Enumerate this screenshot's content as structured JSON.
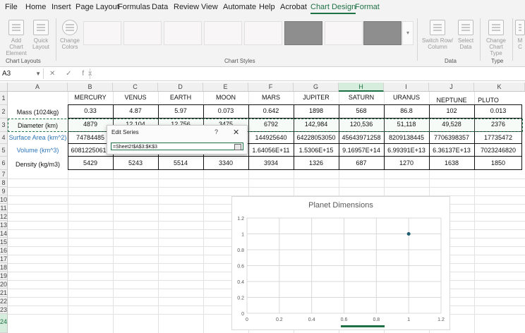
{
  "menu": {
    "tabs": [
      "File",
      "Home",
      "Insert",
      "Page Layout",
      "Formulas",
      "Data",
      "Review",
      "View",
      "Automate",
      "Help",
      "Acrobat",
      "Chart Design",
      "Format"
    ],
    "active": "Chart Design"
  },
  "ribbon": {
    "add_chart_element": "Add Chart Element",
    "quick_layout": "Quick Layout",
    "change_colors": "Change Colors",
    "chart_layouts_label": "Chart Layouts",
    "chart_styles_label": "Chart Styles",
    "switch_row_column": "Switch Row/ Column",
    "select_data": "Select Data",
    "data_label": "Data",
    "change_chart_type": "Change Chart Type",
    "type_label": "Type",
    "move_chart": "M C"
  },
  "formula_bar": {
    "name_box": "A3",
    "icons": "✕ ✓ fx",
    "formula": ""
  },
  "columns": [
    "A",
    "B",
    "C",
    "D",
    "E",
    "F",
    "G",
    "H",
    "I",
    "J",
    "K"
  ],
  "selected_column": "H",
  "rows": [
    "1",
    "2",
    "3",
    "4",
    "5",
    "6",
    "7",
    "8",
    "9",
    "10",
    "11",
    "12",
    "13",
    "14",
    "15",
    "16",
    "17",
    "18",
    "19",
    "20",
    "21",
    "22",
    "23",
    "24"
  ],
  "sheet": {
    "headers": [
      "",
      "MERCURY",
      "VENUS",
      "EARTH",
      "MOON",
      "MARS",
      "JUPITER",
      "SATURN",
      "URANUS",
      "NEPTUNE",
      "PLUTO"
    ],
    "mass": [
      "Mass (1024kg)",
      "0.33",
      "4.87",
      "5.97",
      "0.073",
      "0.642",
      "1898",
      "568",
      "86.8",
      "102",
      "0.013"
    ],
    "diameter": [
      "Diameter (km)",
      "4879",
      "12,104",
      "12,756",
      "3475",
      "6792",
      "142,984",
      "120,536",
      "51,118",
      "49,528",
      "2376"
    ],
    "surface": [
      "Surface Area (km^2)",
      "74784485",
      "",
      "",
      "",
      "144925640",
      "64228053050",
      "45643971258",
      "8209138445",
      "7706398357",
      "17735472"
    ],
    "volume": [
      "Volume (km^3)",
      "60812250619",
      "",
      "",
      "",
      "1.64056E+11",
      "1.5306E+15",
      "9.16957E+14",
      "6.99391E+13",
      "6.36137E+13",
      "7023246820"
    ],
    "density": [
      "Density (kg/m3)",
      "5429",
      "5243",
      "5514",
      "3340",
      "3934",
      "1326",
      "687",
      "1270",
      "1638",
      "1850"
    ]
  },
  "dialog": {
    "title": "Edit Series",
    "help": "?",
    "close": "✕",
    "value": "=Sheet2!$A$3:$K$3"
  },
  "chart_data": {
    "type": "scatter",
    "title": "Planet Dimensions",
    "x_ticks": [
      "0",
      "0.2",
      "0.4",
      "0.6",
      "0.8",
      "1",
      "1.2"
    ],
    "y_ticks": [
      "0",
      "0.2",
      "0.4",
      "0.6",
      "0.8",
      "1",
      "1.2"
    ],
    "xlim": [
      0,
      1.2
    ],
    "ylim": [
      0,
      1.2
    ],
    "grid": true,
    "points": [
      {
        "x": 1,
        "y": 1
      }
    ],
    "marker_color": "#1f5e6e"
  }
}
